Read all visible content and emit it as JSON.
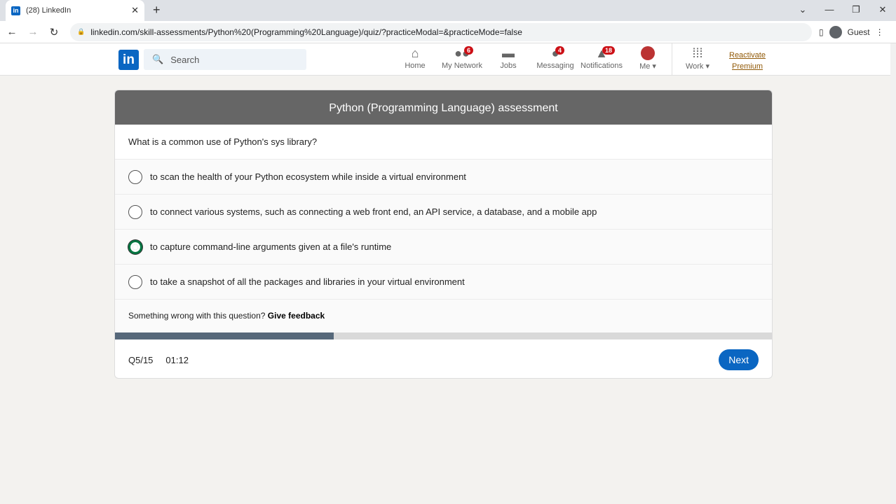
{
  "browser": {
    "tab_title": "(28) LinkedIn",
    "url": "linkedin.com/skill-assessments/Python%20(Programming%20Language)/quiz/?practiceModal=&practiceMode=false",
    "profile": "Guest"
  },
  "header": {
    "search_placeholder": "Search",
    "nav": [
      {
        "label": "Home",
        "icon": "home-icon"
      },
      {
        "label": "My Network",
        "icon": "network-icon",
        "badge": "6"
      },
      {
        "label": "Jobs",
        "icon": "briefcase-icon"
      },
      {
        "label": "Messaging",
        "icon": "message-icon",
        "badge": "4"
      },
      {
        "label": "Notifications",
        "icon": "bell-icon",
        "badge": "18"
      },
      {
        "label": "Me"
      },
      {
        "label": "Work"
      }
    ],
    "premium_line1": "Reactivate",
    "premium_line2": "Premium"
  },
  "quiz": {
    "title": "Python (Programming Language) assessment",
    "question": "What is a common use of Python's sys library?",
    "options": [
      {
        "text": "to scan the health of your Python ecosystem while inside a virtual environment",
        "selected": false
      },
      {
        "text": "to connect various systems, such as connecting a web front end, an API service, a database, and a mobile app",
        "selected": false
      },
      {
        "text": "to capture command-line arguments given at a file's runtime",
        "selected": true
      },
      {
        "text": "to take a snapshot of all the packages and libraries in your virtual environment",
        "selected": false
      }
    ],
    "feedback_prompt": "Something wrong with this question?",
    "feedback_link": "Give feedback",
    "progress_fraction": 0.333,
    "question_counter": "Q5/15",
    "timer": "01:12",
    "next_label": "Next"
  },
  "colors": {
    "accent": "#0a66c2",
    "selected": "#057642",
    "header_bg": "#666666"
  }
}
